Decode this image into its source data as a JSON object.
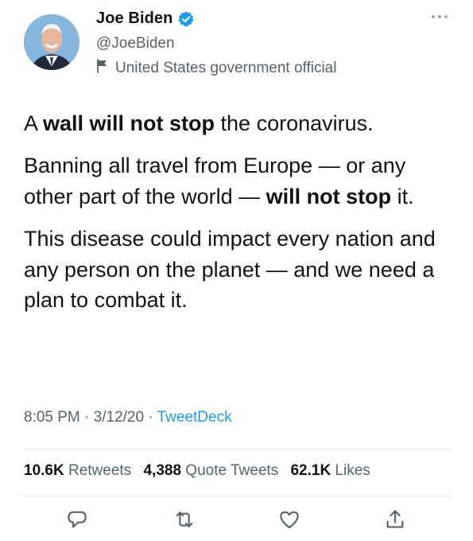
{
  "author": {
    "name": "Joe Biden",
    "handle": "@JoeBiden",
    "label": "United States government official",
    "verified": true
  },
  "tweet": {
    "p1": {
      "a": "A ",
      "b": "wall will not stop",
      "c": " the coronavirus."
    },
    "p2": {
      "a": "Banning all travel from Europe — or any other part of the world — ",
      "b": "will not stop",
      "c": " it."
    },
    "p3": "This disease could impact every nation and any person on the planet — and we need a plan to combat it."
  },
  "meta": {
    "time": "8:05 PM",
    "date": "3/12/20",
    "source": "TweetDeck",
    "sep": "·"
  },
  "stats": {
    "retweets": {
      "count": "10.6K",
      "label": "Retweets"
    },
    "quotes": {
      "count": "4,388",
      "label": "Quote Tweets"
    },
    "likes": {
      "count": "62.1K",
      "label": "Likes"
    }
  },
  "icons": {
    "more": "more-icon",
    "verified": "verified-badge-icon",
    "flag": "flag-icon",
    "reply": "reply-icon",
    "retweet": "retweet-icon",
    "like": "like-icon",
    "share": "share-icon"
  },
  "colors": {
    "accent": "#1d9bf0",
    "text": "#0f1419",
    "secondary": "#536471"
  }
}
